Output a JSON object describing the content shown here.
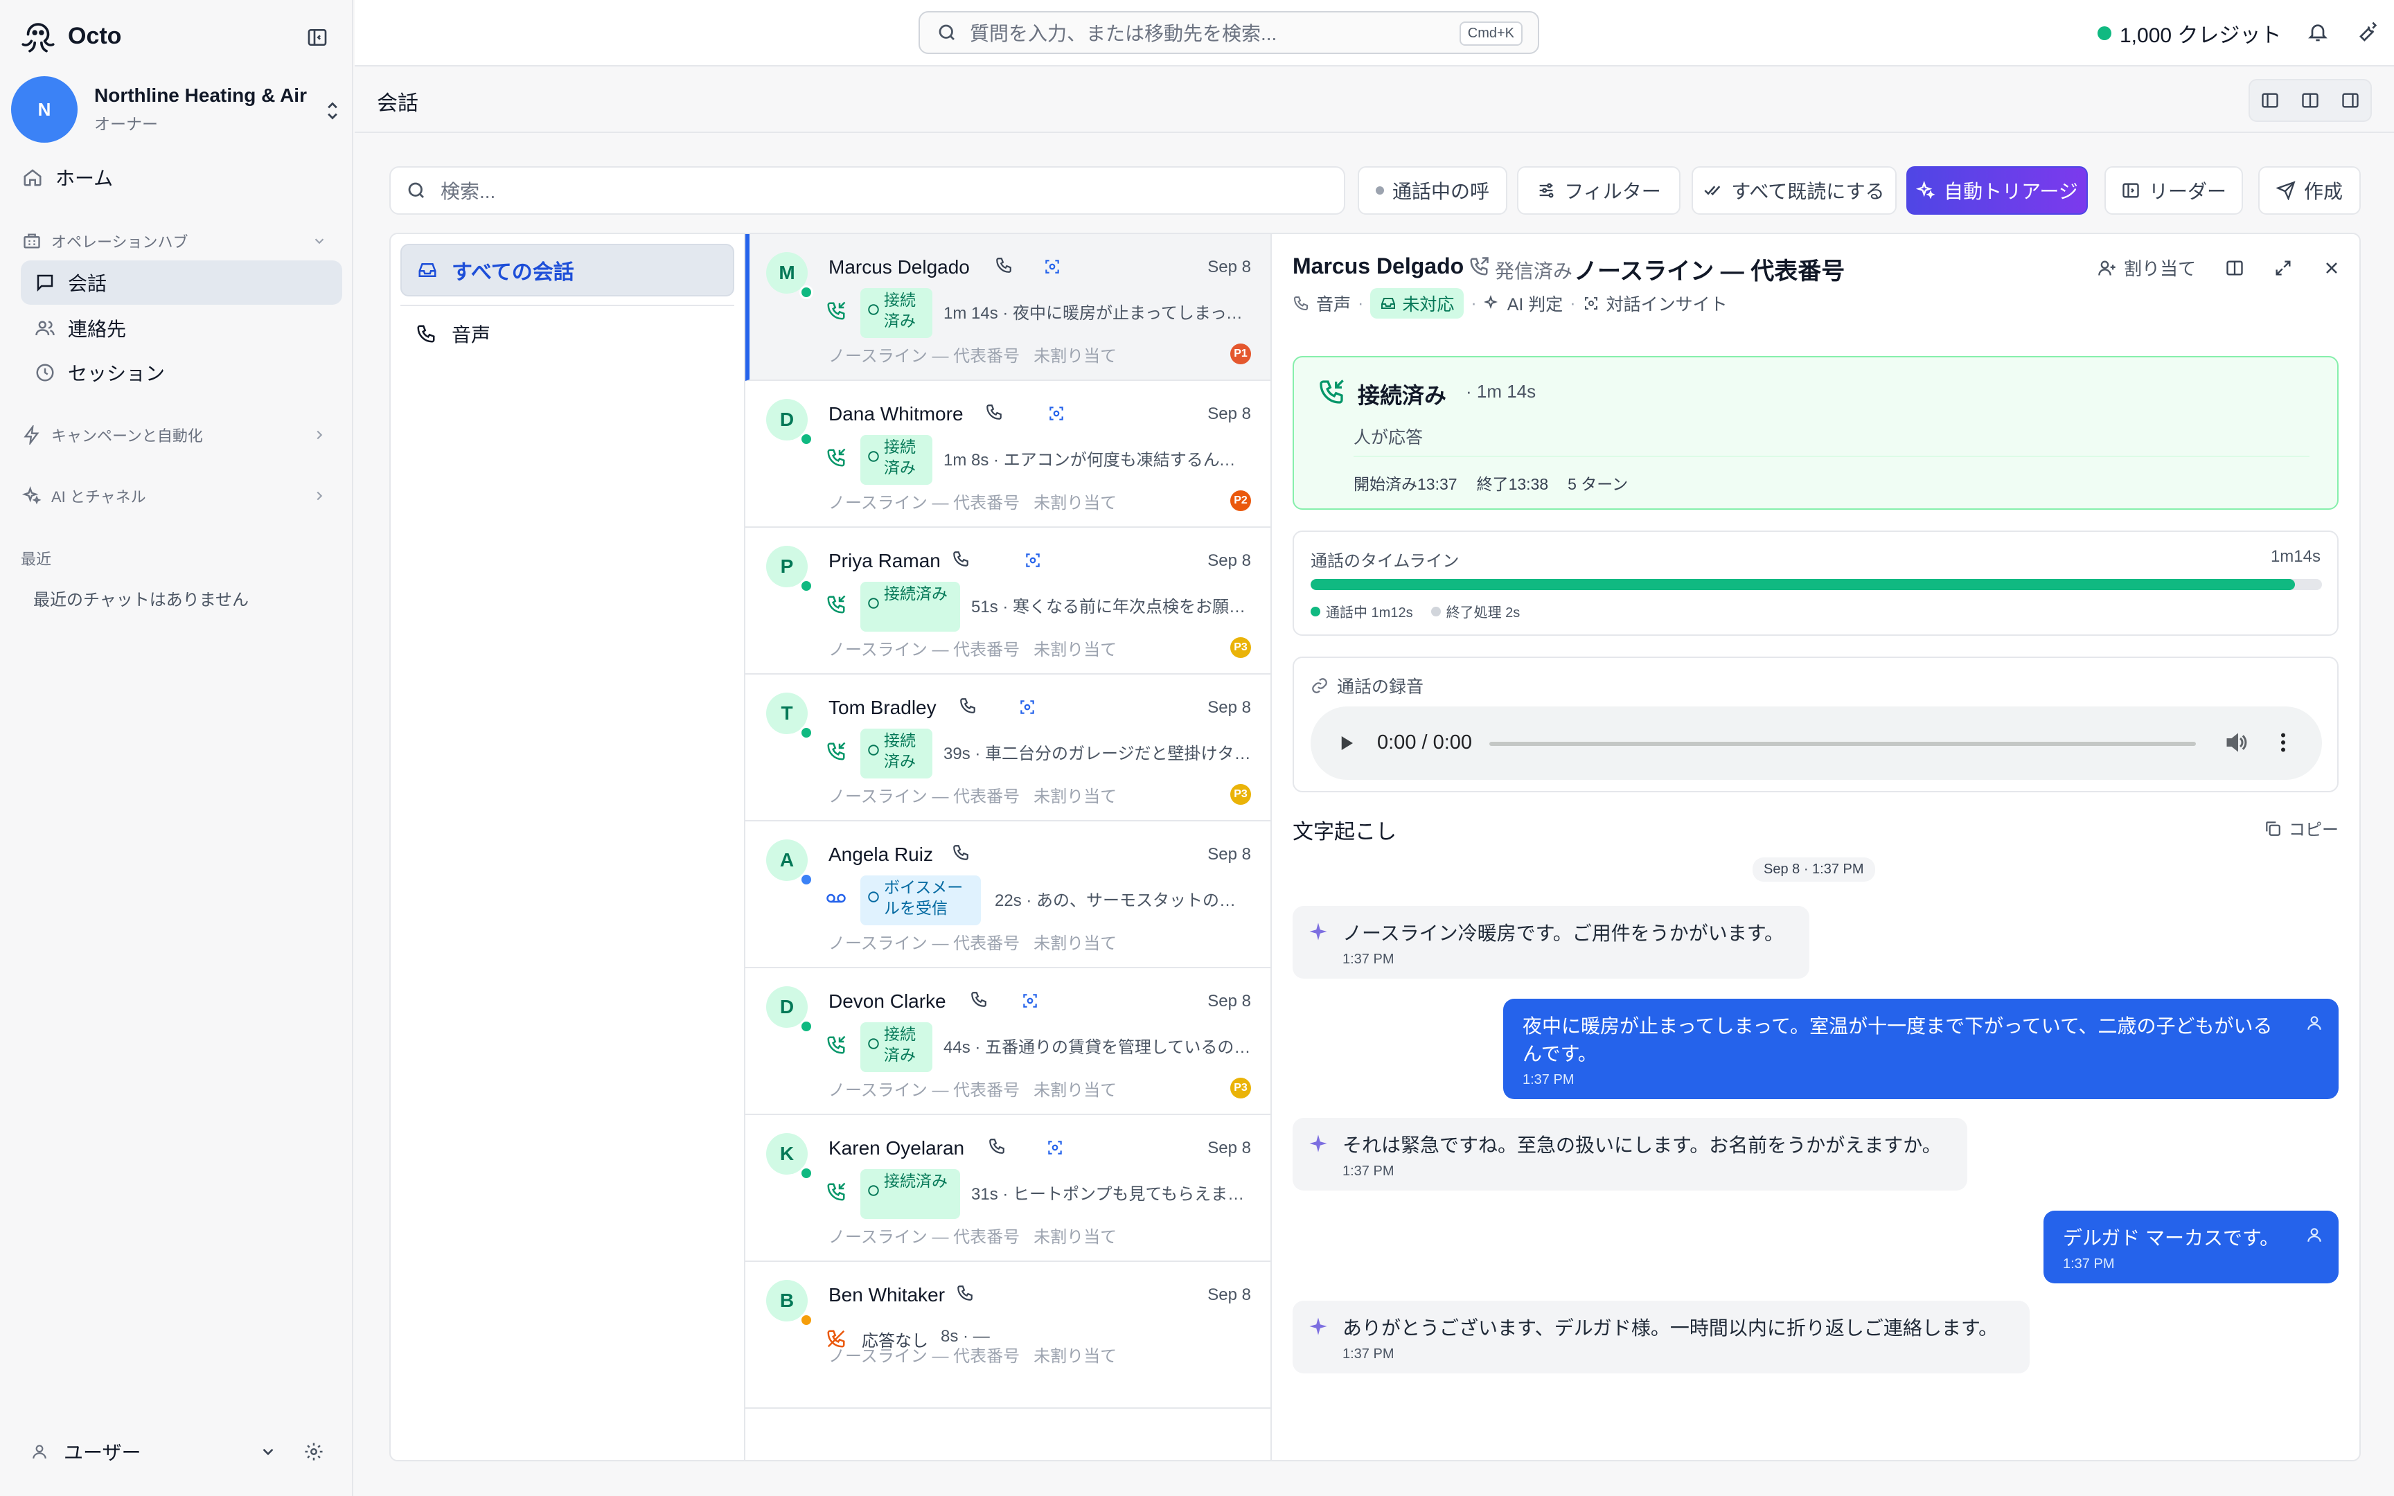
{
  "app": {
    "name": "Octo"
  },
  "org": {
    "initial": "N",
    "name": "Northline Heating & Air",
    "role": "オーナー"
  },
  "nav": {
    "home": "ホーム",
    "ops_section": "オペレーションハブ",
    "conversations": "会話",
    "contacts": "連絡先",
    "sessions": "セッション",
    "campaigns": "キャンペーンと自動化",
    "ai_channels": "AI とチャネル",
    "recent_title": "最近",
    "recent_empty": "最近のチャットはありません",
    "user": "ユーザー"
  },
  "topbar": {
    "search_placeholder": "質問を入力、または移動先を検索...",
    "search_shortcut": "Cmd+K",
    "credits": "1,000 クレジット",
    "credits_color": "#10b981"
  },
  "page": {
    "title": "会話"
  },
  "toolbar": {
    "search_placeholder": "検索...",
    "active_calls": "通話中の呼",
    "filter": "フィルター",
    "mark_all_read": "すべて既読にする",
    "auto_triage": "自動トリアージ",
    "reader": "リーダー",
    "compose": "作成"
  },
  "filters": {
    "all": "すべての会話",
    "voice": "音声"
  },
  "conversations": [
    {
      "initial": "M",
      "name": "Marcus Delgado",
      "date": "Sep 8",
      "status": "接続済み",
      "duration": "1m 14s",
      "snippet": "· 夜中に暖房が止まってしまって、室温が十一度まで下がっていて…",
      "line": "ノースライン — 代表番号",
      "assignee": "未割り当て",
      "priority": "P1",
      "priority_color": "#e4572e",
      "dot_color": "#10b981"
    },
    {
      "initial": "D",
      "name": "Dana Whitmore",
      "date": "Sep 8",
      "status": "接続済み",
      "duration": "1m 8s",
      "snippet": "· エアコンが何度も凍結するんです…",
      "line": "ノースライン — 代表番号",
      "assignee": "未割り当て",
      "priority": "P2",
      "priority_color": "#ea580c",
      "dot_color": "#10b981"
    },
    {
      "initial": "P",
      "name": "Priya Raman",
      "date": "Sep 8",
      "status": "接続済み",
      "duration": "51s",
      "snippet": "· 寒くなる前に年次点検をお願いしたくて…",
      "line": "ノースライン — 代表番号",
      "assignee": "未割り当て",
      "priority": "P3",
      "priority_color": "#eab308",
      "dot_color": "#10b981"
    },
    {
      "initial": "T",
      "name": "Tom Bradley",
      "date": "Sep 8",
      "status": "接続済み",
      "duration": "39s",
      "snippet": "· 車二台分のガレージだと壁掛けタイプで足りますか…",
      "line": "ノースライン — 代表番号",
      "assignee": "未割り当て",
      "priority": "P3",
      "priority_color": "#eab308",
      "dot_color": "#10b981"
    },
    {
      "initial": "A",
      "name": "Angela Ruiz",
      "date": "Sep 8",
      "status": "ボイスメールを受信",
      "duration": "22s",
      "snippet": "· あの、サーモスタットの表示が消えてしまって…",
      "line": "ノースライン — 代表番号",
      "assignee": "未割り当て",
      "priority": "",
      "priority_color": "",
      "dot_color": "#3b82f6"
    },
    {
      "initial": "D",
      "name": "Devon Clarke",
      "date": "Sep 8",
      "status": "接続済み",
      "duration": "44s",
      "snippet": "· 五番通りの賃貸を管理しているのですが…",
      "line": "ノースライン — 代表番号",
      "assignee": "未割り当て",
      "priority": "P3",
      "priority_color": "#eab308",
      "dot_color": "#10b981"
    },
    {
      "initial": "K",
      "name": "Karen Oyelaran",
      "date": "Sep 8",
      "status": "接続済み",
      "duration": "31s",
      "snippet": "· ヒートポンプも見てもらえますか…",
      "line": "ノースライン — 代表番号",
      "assignee": "未割り当て",
      "priority": "",
      "priority_color": "",
      "dot_color": "#10b981"
    },
    {
      "initial": "B",
      "name": "Ben Whitaker",
      "date": "Sep 8",
      "status": "応答なし",
      "duration": "8s",
      "snippet": "· —",
      "line": "ノースライン — 代表番号",
      "assignee": "未割り当て",
      "priority": "",
      "priority_color": "",
      "dot_color": "#f59e0b"
    }
  ],
  "detail": {
    "name": "Marcus Delgado",
    "direction": "発信済み",
    "line": "ノースライン — 代表番号",
    "channel": "音声",
    "state": "未対応",
    "ai_verdict": "AI 判定",
    "insights": "対話インサイト",
    "assign": "割り当て",
    "connected_title": "接続済み",
    "connected_duration": "· 1m 14s",
    "connected_sub": "人が応答",
    "started": "開始済み13:37",
    "ended": "終了13:38",
    "turns": "5 ターン",
    "timeline_title": "通話のタイムライン",
    "timeline_total": "1m14s",
    "timeline_in_call": "通話中 1m12s",
    "timeline_wrap": "終了処理 2s",
    "timeline_in_call_fraction": 0.973,
    "recording_title": "通話の録音",
    "player_time": "0:00 / 0:00",
    "transcript_title": "文字起こし",
    "copy": "コピー",
    "stamp": "Sep 8 · 1:37 PM"
  },
  "transcript": [
    {
      "role": "ai",
      "text": "ノースライン冷暖房です。ご用件をうかがいます。",
      "time": "1:37 PM"
    },
    {
      "role": "caller",
      "text": "夜中に暖房が止まってしまって。室温が十一度まで下がっていて、二歳の子どもがいるんです。",
      "time": "1:37 PM"
    },
    {
      "role": "ai",
      "text": "それは緊急ですね。至急の扱いにします。お名前をうかがえますか。",
      "time": "1:37 PM"
    },
    {
      "role": "caller",
      "text": "デルガド マーカスです。",
      "time": "1:37 PM"
    },
    {
      "role": "ai",
      "text": "ありがとうございます、デルガド様。一時間以内に折り返しご連絡します。",
      "time": "1:37 PM"
    }
  ]
}
